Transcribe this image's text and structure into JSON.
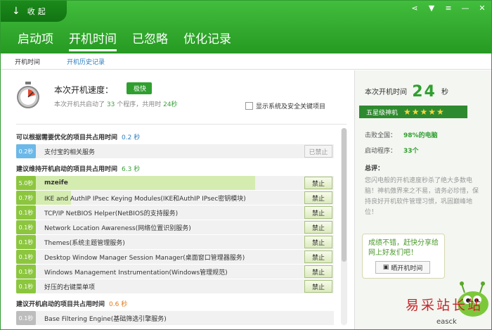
{
  "window": {
    "collapse_label": "收起",
    "tabs": [
      {
        "label": "启动项"
      },
      {
        "label": "开机时间"
      },
      {
        "label": "已忽略"
      },
      {
        "label": "优化记录"
      }
    ],
    "subtabs": [
      {
        "label": "开机时间"
      },
      {
        "label": "开机历史记录"
      }
    ]
  },
  "speed": {
    "title": "本次开机速度：",
    "badge": "极快",
    "desc_prefix": "本次开机共启动了",
    "program_count": "33",
    "desc_mid": "个程序，共用时",
    "total_time": "24秒",
    "checkbox_label": "显示系统及安全关键项目"
  },
  "sections": {
    "optimizable": {
      "title": "可以根据需要优化的项目共占用时间",
      "time": "0.2 秒"
    },
    "maintain": {
      "title": "建议维持开机启动的项目共占用时间",
      "time": "6.3 秒"
    },
    "keep": {
      "title": "建议开机启动的项目共占用时间",
      "time": "0.6 秒"
    }
  },
  "items": [
    {
      "time": "0.2秒",
      "name": "支付宝的相关服务",
      "button": "已禁止",
      "fill": 0.03
    },
    {
      "time": "5.0秒",
      "name": "mzeife",
      "button": "禁止",
      "fill": 0.83
    },
    {
      "time": "0.7秒",
      "name": "IKE and AuthIP IPsec Keying Modules(IKE和AuthIP IPsec密钥模块)",
      "button": "禁止",
      "fill": 0.19
    },
    {
      "time": "0.1秒",
      "name": "TCP/IP NetBIOS Helper(NetBIOS的支持服务)",
      "button": "禁止",
      "fill": 0.0
    },
    {
      "time": "0.1秒",
      "name": "Network Location Awareness(网络位置识别服务)",
      "button": "禁止",
      "fill": 0.0
    },
    {
      "time": "0.1秒",
      "name": "Themes(系统主题管理服务)",
      "button": "禁止",
      "fill": 0.0
    },
    {
      "time": "0.1秒",
      "name": "Desktop Window Manager Session Manager(桌面窗口管理器服务)",
      "button": "禁止",
      "fill": 0.0
    },
    {
      "time": "0.1秒",
      "name": "Windows Management Instrumentation(Windows管理规范)",
      "button": "禁止",
      "fill": 0.0
    },
    {
      "time": "0.1秒",
      "name": "好压的右键菜单项",
      "button": "禁止",
      "fill": 0.0
    },
    {
      "time": "0.1秒",
      "name": "Base Filtering Engine(基础筛选引擎服务)",
      "button": "",
      "fill": 0.0
    }
  ],
  "right": {
    "time_label": "本次开机时间",
    "time_value": "24",
    "time_unit": "秒",
    "level_label": "五星级神机",
    "stars": "★★★★★",
    "beat_label": "击败全国：",
    "beat_value": "98%的电脑",
    "programs_label": "启动程序：",
    "programs_value": "33个",
    "summary_label": "总评：",
    "summary_text": "您闪电般的开机速度秒杀了绝大多数电脑！神机傲界来之不易，请务必珍惜，保持良好开机软件管理习惯，巩固巅峰地位！",
    "share_text": "成绩不错，赶快分享给网上好友们吧！",
    "share_button": "晒开机时间"
  },
  "watermark": {
    "text": "易采站长站",
    "sub": "easck"
  },
  "icons": [
    "collapse-arrow-icon",
    "share-icon",
    "skin-icon",
    "menu-icon",
    "minimize-icon",
    "close-icon",
    "stopwatch-icon",
    "camera-icon",
    "mascot-icon"
  ]
}
